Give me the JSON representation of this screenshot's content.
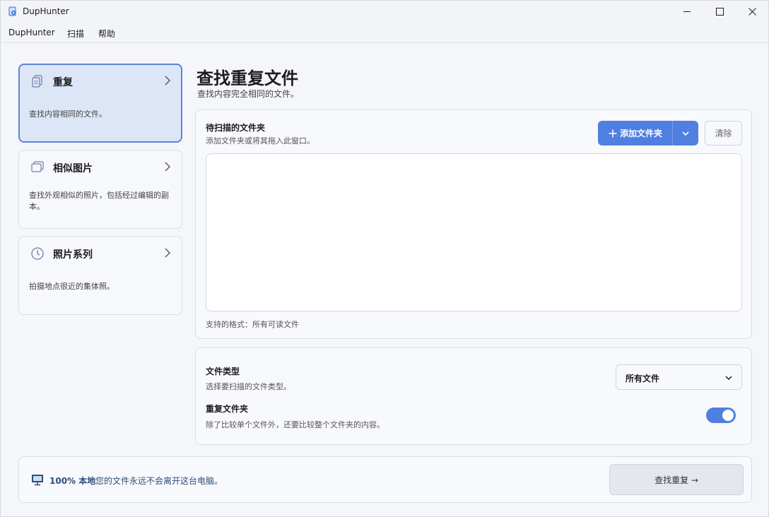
{
  "window": {
    "title": "DupHunter"
  },
  "menu": {
    "items": [
      {
        "label": "DupHunter"
      },
      {
        "label": "扫描"
      },
      {
        "label": "帮助"
      }
    ]
  },
  "sidebar": {
    "modes": [
      {
        "title": "重复",
        "description": "查找内容相同的文件。",
        "icon": "duplicate-files-icon",
        "active": true
      },
      {
        "title": "相似图片",
        "description": "查找外观相似的照片，包括经过编辑的副本。",
        "icon": "similar-images-icon",
        "active": false
      },
      {
        "title": "照片系列",
        "description": "拍摄地点很近的集体照。",
        "icon": "clock-icon",
        "active": false
      }
    ]
  },
  "main": {
    "title": "查找重复文件",
    "subtitle": "查找内容完全相同的文件。",
    "folders": {
      "title": "待扫描的文件夹",
      "description": "添加文件夹或将其拖入此窗口。",
      "add_button": "添加文件夹",
      "clear_button": "清除",
      "supported_formats": "支持的格式：所有可读文件"
    },
    "options": {
      "file_type_title": "文件类型",
      "file_type_desc": "选择要扫描的文件类型。",
      "file_type_value": "所有文件",
      "dup_folders_title": "重复文件夹",
      "dup_folders_desc": "除了比较单个文件外，还要比较整个文件夹的内容。",
      "dup_folders_enabled": true
    }
  },
  "footer": {
    "local_badge": "100% 本地",
    "privacy_note": "您的文件永远不会离开这台电脑。",
    "find_button": "查找重复 →"
  },
  "colors": {
    "accent": "#4f7fe0",
    "active_card_bg": "#dde6f7",
    "active_card_border": "#5b86d9"
  }
}
